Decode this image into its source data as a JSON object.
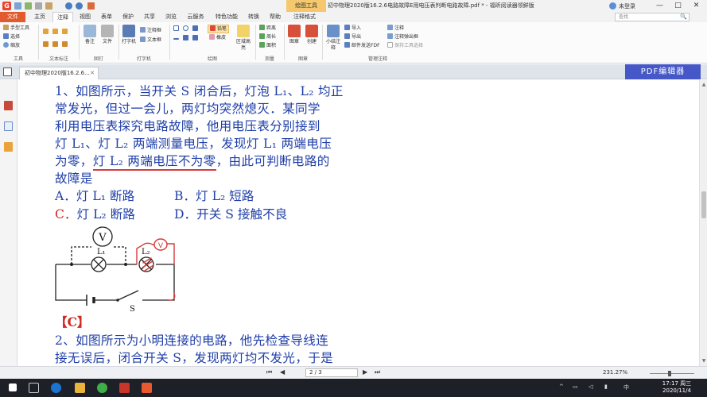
{
  "window": {
    "context_tab": "绘图工具",
    "title": "初中物理2020版16.2.6电路故障E用电压表判断电路故障.pdf * - 福昕阅读器领鲜版",
    "user": "未登录",
    "min": "—",
    "max": "□",
    "close": "✕"
  },
  "menu": {
    "tabs": [
      "文件",
      "主页",
      "注释",
      "视图",
      "表单",
      "保护",
      "共享",
      "浏览",
      "云服务",
      "特色功能",
      "转换",
      "帮助",
      "注释格式"
    ],
    "search_placeholder": "查找",
    "search_icon": "🔍"
  },
  "ribbon": {
    "tools": [
      "手型工具",
      "选择",
      "缩放"
    ],
    "tools_group": "工具",
    "text_markup_group": "文本标注",
    "pin_group_items": [
      "备注",
      "文件"
    ],
    "pin_group": "固钉",
    "typewriter": "打字机",
    "typewriter_items": [
      "注释框",
      "文本框"
    ],
    "typewriter_group": "打字机",
    "drawing_items": [
      "铅笔",
      "橡皮"
    ],
    "area": "区域高亮",
    "drawing_group": "绘图",
    "measure_items": [
      "距离",
      "周长",
      "面积"
    ],
    "measure_group": "测量",
    "stamp_items": [
      "图章",
      "创建"
    ],
    "stamp_group": "图章",
    "small_note": "小结注释",
    "manage_items": [
      "导入",
      "导出",
      "邮件发送FDF"
    ],
    "manage_items2": [
      "注释",
      "注释弹出框",
      "保持工具选择"
    ],
    "manage_group": "管理注释"
  },
  "doc_tab": {
    "label": "初中物理2020版16.2.6...",
    "close": "✕",
    "pdf_edit": "PDF编辑器"
  },
  "question1": {
    "line1": "1、如图所示，当开关 S 闭合后，灯泡 L₁、L₂ 均正",
    "line2": "常发光，但过一会儿，两灯均突然熄灭．某同学",
    "line3": "利用电压表探究电路故障，他用电压表分别接到",
    "line4": "灯 L₁、灯 L₂ 两端测量电压，发现灯 L₁ 两端电压",
    "line5_a": "为零，",
    "line5_underlined": "灯 L₂ 两端电压不为零",
    "line5_b": "，由此可判断电路的",
    "line6": "故障是",
    "choice_a": "A．灯 L₁ 断路",
    "choice_b": "B．灯 L₂ 短路",
    "choice_c_letter": "C．",
    "choice_c_text": "灯 L₂ 断路",
    "choice_d": "D．开关 S 接触不良",
    "answer": "【C】"
  },
  "circuit": {
    "meter": "V",
    "lamp1": "L₁",
    "lamp2": "L₂",
    "switch": "S",
    "hand_meter": "V"
  },
  "question2": {
    "line1": "2、如图所示为小明连接的电路，他先检查导线连",
    "line2": "接无误后，闭合开关 S，发现两灯均不发光，于是"
  },
  "status": {
    "first": "⏮",
    "prev": "◀",
    "page": "2 / 3",
    "next": "▶",
    "last": "⏭",
    "zoom": "231.27%",
    "zoom_level_fraction": 0.45
  },
  "taskbar": {
    "time": "17:17 周三",
    "date": "2020/11/4",
    "ime": "中"
  },
  "colors": {
    "file_tab": "#e25b2e",
    "pdf_edit": "#4658c7",
    "doc_text": "#1f3ea8",
    "red_ink": "#d0281f"
  }
}
